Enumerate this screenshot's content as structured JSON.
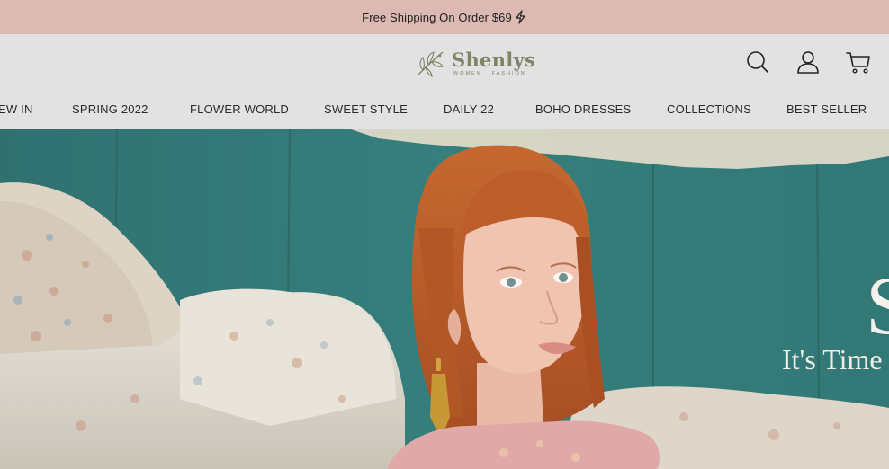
{
  "announcement": {
    "text": "Free Shipping On Order $69",
    "icon": "lightning-bolt-icon"
  },
  "brand": {
    "name": "Shenlys",
    "tagline": "WOMEN · FASHION",
    "color": "#7e8468"
  },
  "header_icons": [
    "search-icon",
    "account-icon",
    "cart-icon"
  ],
  "nav": {
    "items": [
      {
        "label": "EW IN"
      },
      {
        "label": "SPRING 2022"
      },
      {
        "label": "FLOWER WORLD"
      },
      {
        "label": "SWEET STYLE"
      },
      {
        "label": "DAILY 22"
      },
      {
        "label": "BOHO DRESSES"
      },
      {
        "label": "COLLECTIONS"
      },
      {
        "label": "BEST SELLER"
      }
    ]
  },
  "hero": {
    "big_letter": "S",
    "tagline": "It's Time"
  },
  "colors": {
    "announcement_bg": "#dcbab3",
    "header_bg": "#e2e2e2",
    "hero_wall": "#2f7b79"
  }
}
